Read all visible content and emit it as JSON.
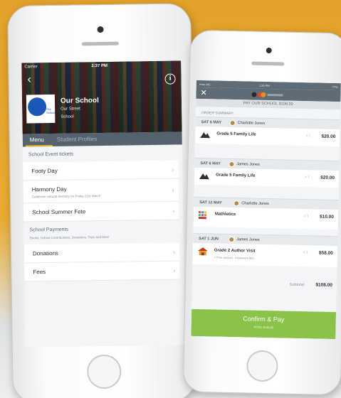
{
  "left_phone": {
    "status": {
      "carrier": "Carrier",
      "time": "2:37 PM"
    },
    "school": {
      "name": "Our School",
      "street": "Our Street",
      "type": "School",
      "logo_text": "Our School"
    },
    "tabs": [
      {
        "label": "Menu"
      },
      {
        "label": "Student Profiles"
      }
    ],
    "event_section": {
      "label": "School Event tickets",
      "items": [
        {
          "title": "Footy Day",
          "subtitle": ""
        },
        {
          "title": "Harmony Day",
          "subtitle": "Celebrate cultural diversity on Friday 21st March"
        },
        {
          "title": "School Summer Fete",
          "subtitle": ""
        }
      ]
    },
    "payments_section": {
      "label": "School Payments",
      "subtitle": "Books, School Contributions, Donations, Trips and More",
      "items": [
        {
          "title": "Donations"
        },
        {
          "title": "Fees"
        }
      ]
    }
  },
  "right_phone": {
    "status": {
      "carrier": "•••oo MC",
      "time": "1:20 PM",
      "battery": "77%"
    },
    "pay_header": "PAY OUR SCHOOL $108.00",
    "order_summary_label": "ORDER SUMMARY",
    "orders": [
      {
        "date": "SAT 6 MAY",
        "name": "Charlotte Jones",
        "item": "Grade 5 Family Life",
        "qty": "x 1",
        "price": "$20.00",
        "sub": "",
        "icon": "mountain-icon"
      },
      {
        "date": "SAT 6 MAY",
        "name": "James Jones",
        "item": "Grade 5 Family Life",
        "qty": "x 1",
        "price": "$20.00",
        "sub": "",
        "icon": "mountain-icon"
      },
      {
        "date": "SAT 12 MAY",
        "name": "Charlotte Jones",
        "item": "Mathletics",
        "qty": "x 1",
        "price": "$10.00",
        "sub": "",
        "icon": "mathletics-logo-icon"
      },
      {
        "date": "SAT 1 JUN",
        "name": "James Jones",
        "item": "Grade 2 Author Visit",
        "qty": "x 1",
        "price": "$58.00",
        "sub": "+ Free amount · Instalment $50",
        "icon": "author-visit-icon"
      }
    ],
    "subtotal_label": "Subtotal",
    "subtotal_value": "$108.00",
    "confirm_label": "Confirm & Pay",
    "confirm_total": "TOTAL $108.00"
  },
  "colors": {
    "background": "#e9ab33",
    "tab_bar": "#56626d",
    "accent_underline": "#f1b533",
    "confirm": "#8bc34a",
    "logo_blue": "#1c58b8"
  }
}
